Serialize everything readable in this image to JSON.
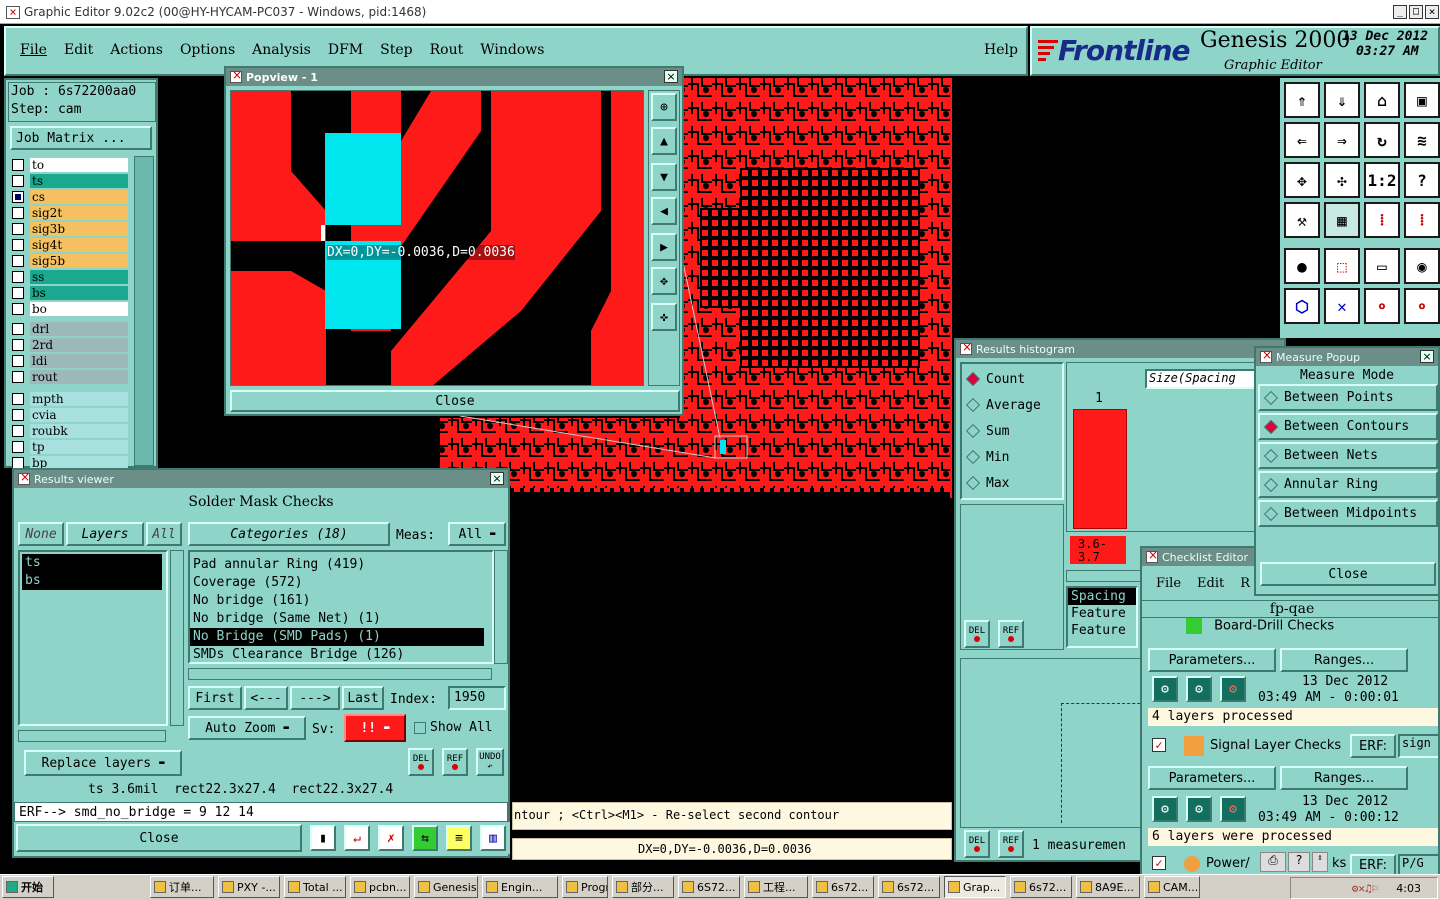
{
  "window_title": "Graphic Editor 9.02c2 (00@HY-HYCAM-PC037 - Windows, pid:1468)",
  "menu": [
    "File",
    "Edit",
    "Actions",
    "Options",
    "Analysis",
    "DFM",
    "Step",
    "Rout",
    "Windows"
  ],
  "help_label": "Help",
  "brand": {
    "logo": "Frontline",
    "product": "Genesis 2000",
    "subtitle": "Graphic Editor",
    "date": "13 Dec 2012",
    "time": "03:27 AM"
  },
  "job": {
    "job_line": "Job  :  6s72200aa0",
    "step_line": "Step:  cam",
    "matrix_button": "Job Matrix ..."
  },
  "layers": [
    {
      "name": "to",
      "color": "#ffffff",
      "checked": false
    },
    {
      "name": "ts",
      "color": "#1aa88e",
      "checked": false
    },
    {
      "name": "cs",
      "color": "#f4c060",
      "checked": true
    },
    {
      "name": "sig2t",
      "color": "#f4c060",
      "checked": false
    },
    {
      "name": "sig3b",
      "color": "#f4c060",
      "checked": false
    },
    {
      "name": "sig4t",
      "color": "#f4c060",
      "checked": false
    },
    {
      "name": "sig5b",
      "color": "#f4c060",
      "checked": false
    },
    {
      "name": "ss",
      "color": "#1aa88e",
      "checked": false
    },
    {
      "name": "bs",
      "color": "#1aa88e",
      "checked": false
    },
    {
      "name": "bo",
      "color": "#ffffff",
      "checked": false
    },
    {
      "name": "drl",
      "color": "#9cb8b8",
      "checked": false
    },
    {
      "name": "2rd",
      "color": "#9cb8b8",
      "checked": false
    },
    {
      "name": "ldi",
      "color": "#9cb8b8",
      "checked": false
    },
    {
      "name": "rout",
      "color": "#9cb8b8",
      "checked": false
    },
    {
      "name": "mpth",
      "color": "#a8e0e0",
      "checked": false
    },
    {
      "name": "cvia",
      "color": "#a8e0e0",
      "checked": false
    },
    {
      "name": "roubk",
      "color": "#a8e0e0",
      "checked": false
    },
    {
      "name": "tp",
      "color": "#a8e0e0",
      "checked": false
    },
    {
      "name": "bp",
      "color": "#a8e0e0",
      "checked": false
    }
  ],
  "popview": {
    "title": "Popview - 1",
    "measure_text": "DX=0,DY=-0.0036,D=0.0036",
    "close": "Close"
  },
  "results_viewer": {
    "title": "Results viewer",
    "header": "Solder Mask Checks",
    "none_btn": "None",
    "layers_btn": "Layers",
    "all_btn": "All",
    "categories_btn": "Categories (18)",
    "meas_label": "Meas:",
    "meas_value": "All",
    "selected_layers": [
      "ts",
      "bs"
    ],
    "categories": [
      "Pad annular Ring (419)",
      "Coverage (572)",
      "No bridge (161)",
      "No bridge (Same Net) (1)",
      "No Bridge (SMD Pads) (1)",
      "SMDs Clearance Bridge (126)"
    ],
    "first": "First",
    "prev": "<---",
    "next": "--->",
    "last": "Last",
    "index_label": "Index:",
    "index_value": "1950",
    "auto_zoom": "Auto Zoom",
    "sv_label": "Sv:",
    "sv_value": "!!",
    "show_all": "Show All",
    "replace_layers": "Replace layers",
    "info_line": "ts 3.6mil  rect22.3x27.4  rect22.3x27.4",
    "erf_line": "ERF--> smd_no_bridge = 9 12 14",
    "close": "Close",
    "del": "DEL",
    "ref": "REF",
    "undo": "UNDO"
  },
  "hint_text": "ntour ; <Ctrl><M1> - Re-select second contour",
  "status_text": "DX=0,DY=-0.0036,D=0.0036",
  "histogram": {
    "title": "Results histogram",
    "options": [
      "Count",
      "Average",
      "Sum",
      "Min",
      "Max"
    ],
    "selected": "Count",
    "size_label": "Size(Spacing",
    "bar_value_label": "1",
    "bar_range": "3.6-\n3.7",
    "spacing_list": [
      "Spacing",
      "Feature",
      "Feature"
    ],
    "measurement": "1 measuremen",
    "del": "DEL",
    "ref": "REF"
  },
  "measure_popup": {
    "title": "Measure Popup",
    "header": "Measure Mode",
    "modes": [
      "Between Points",
      "Between Contours",
      "Between Nets",
      "Annular Ring",
      "Between Midpoints"
    ],
    "selected": "Between Contours",
    "close": "Close"
  },
  "checklist": {
    "title": "Checklist Editor",
    "menu": [
      "File",
      "Edit",
      "R"
    ],
    "name": "fp-qae",
    "row0": "Board-Drill Checks",
    "params": "Parameters...",
    "ranges": "Ranges...",
    "run1": {
      "date": "13 Dec 2012",
      "time": "03:49 AM - 0:00:01",
      "status": "4 layers processed"
    },
    "signal": "Signal Layer Checks",
    "erf": "ERF:",
    "sign": "sign",
    "run2": {
      "date": "13 Dec 2012",
      "time": "03:49 AM - 0:00:12",
      "status": "6 layers were processed"
    },
    "power": "Power/",
    "tks": "ks",
    "pg": "P/G"
  },
  "taskbar": {
    "start": "开始",
    "items": [
      "订单...",
      "PXY -...",
      "Total ...",
      "pcbn...",
      "Genesis",
      "Engin...",
      "Progr...",
      "部分...",
      "6S72...",
      "工程...",
      "6s72...",
      "6s72...",
      "Grap...",
      "6s72...",
      "8A9E...",
      "CAM..."
    ],
    "clock": "4:03"
  }
}
